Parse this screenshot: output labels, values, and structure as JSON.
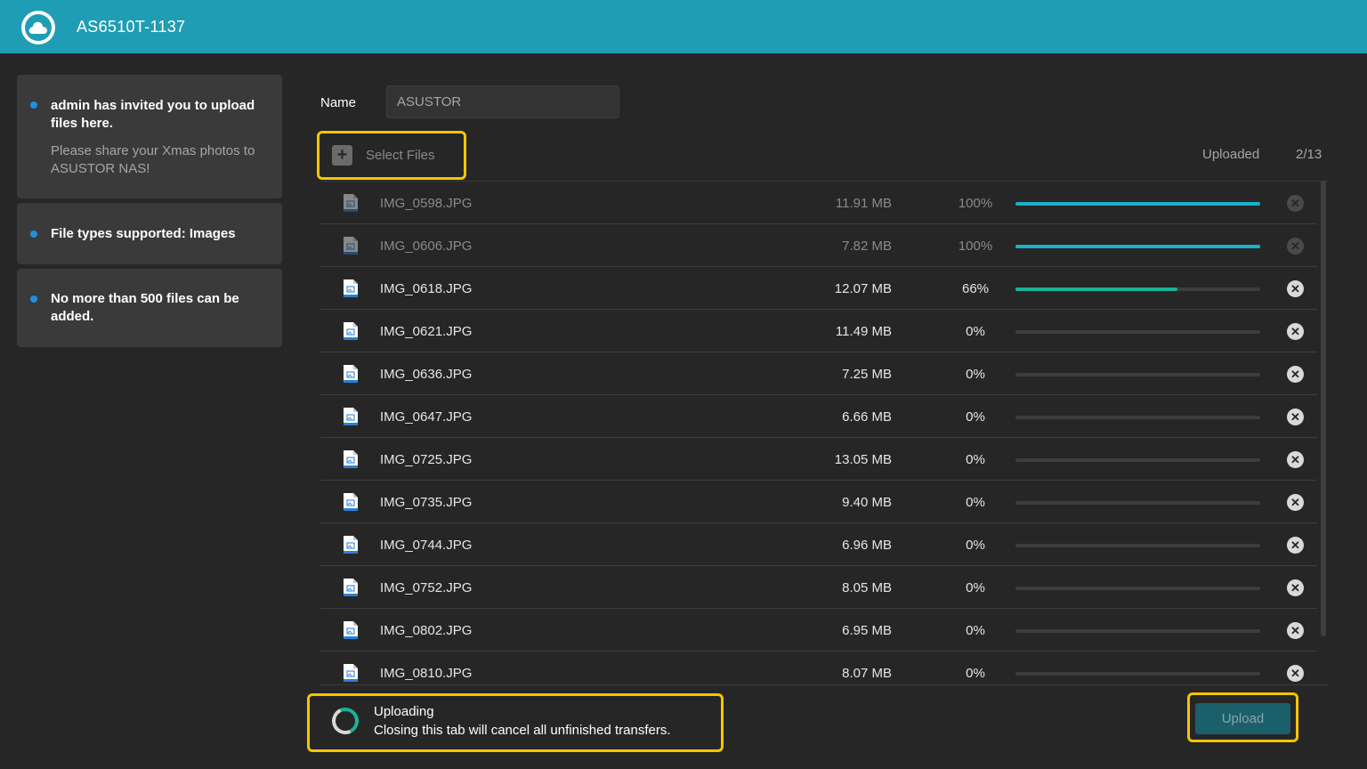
{
  "header": {
    "title": "AS6510T-1137"
  },
  "info_cards": [
    {
      "title": "admin has invited you to upload files here.",
      "subtitle": "Please share your Xmas photos to ASUSTOR NAS!"
    },
    {
      "title": "File types supported: Images"
    },
    {
      "title": "No more than 500 files can be added."
    }
  ],
  "form": {
    "name_label": "Name",
    "name_value": "ASUSTOR"
  },
  "toolbar": {
    "select_files_label": "Select Files",
    "uploaded_label": "Uploaded",
    "uploaded_count": "2/13"
  },
  "files": [
    {
      "name": "IMG_0598.JPG",
      "size": "11.91 MB",
      "progress": "100%",
      "progress_value": 1.0,
      "state": "done"
    },
    {
      "name": "IMG_0606.JPG",
      "size": "7.82 MB",
      "progress": "100%",
      "progress_value": 1.0,
      "state": "done"
    },
    {
      "name": "IMG_0618.JPG",
      "size": "12.07 MB",
      "progress": "66%",
      "progress_value": 0.66,
      "state": "uploading"
    },
    {
      "name": "IMG_0621.JPG",
      "size": "11.49 MB",
      "progress": "0%",
      "progress_value": 0,
      "state": "pending"
    },
    {
      "name": "IMG_0636.JPG",
      "size": "7.25 MB",
      "progress": "0%",
      "progress_value": 0,
      "state": "pending"
    },
    {
      "name": "IMG_0647.JPG",
      "size": "6.66 MB",
      "progress": "0%",
      "progress_value": 0,
      "state": "pending"
    },
    {
      "name": "IMG_0725.JPG",
      "size": "13.05 MB",
      "progress": "0%",
      "progress_value": 0,
      "state": "pending"
    },
    {
      "name": "IMG_0735.JPG",
      "size": "9.40 MB",
      "progress": "0%",
      "progress_value": 0,
      "state": "pending"
    },
    {
      "name": "IMG_0744.JPG",
      "size": "6.96 MB",
      "progress": "0%",
      "progress_value": 0,
      "state": "pending"
    },
    {
      "name": "IMG_0752.JPG",
      "size": "8.05 MB",
      "progress": "0%",
      "progress_value": 0,
      "state": "pending"
    },
    {
      "name": "IMG_0802.JPG",
      "size": "6.95 MB",
      "progress": "0%",
      "progress_value": 0,
      "state": "pending"
    },
    {
      "name": "IMG_0810.JPG",
      "size": "8.07 MB",
      "progress": "0%",
      "progress_value": 0,
      "state": "pending"
    }
  ],
  "status": {
    "title": "Uploading",
    "message": "Closing this tab will cancel all unfinished transfers."
  },
  "actions": {
    "upload_label": "Upload"
  },
  "colors": {
    "header_bg": "#1f9db4",
    "progress_done": "#1ab0c8",
    "progress_active": "#1bb29a",
    "highlight": "#f3c500",
    "bullet": "#1e90e0"
  },
  "icons": {
    "logo": "cloud-icon",
    "file": "image-file-icon",
    "cancel": "close-circle-icon",
    "add": "plus-icon"
  }
}
